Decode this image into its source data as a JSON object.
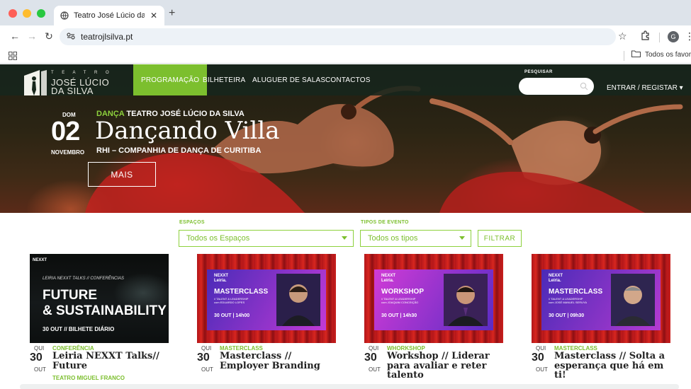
{
  "browser": {
    "tab_title": "Teatro José Lúcio da Silva – ",
    "url": "teatrojlsilva.pt",
    "bookmarks_folder": "Todos os favoritos",
    "profile_initial": "G",
    "icons": [
      "back-icon",
      "forward-icon",
      "reload-icon",
      "site-info-icon",
      "star-icon",
      "extensions-icon",
      "menu-icon",
      "apps-icon",
      "folder-icon"
    ]
  },
  "site": {
    "logo": {
      "small": "T E A T R O",
      "line1": "JOSÉ LÚCIO",
      "line2": "DA SILVA"
    },
    "nav": [
      "PROGRAMAÇÃO",
      "BILHETEIRA",
      "ALUGUER DE SALAS",
      "CONTACTOS"
    ],
    "search_label": "PESQUISAR",
    "login": "ENTRAR / REGISTAR ▾",
    "colors": {
      "accent": "#7cbf2e",
      "nav_bg": "#17261c"
    }
  },
  "hero": {
    "day_of_week": "DOM",
    "day": "02",
    "month": "NOVEMBRO",
    "category": "DANÇA",
    "venue": "TEATRO JOSÉ LÚCIO DA SILVA",
    "title": "Dançando Villa",
    "company": "RHI – COMPANHIA DE DANÇA DE CURITIBA",
    "more_button": "MAIS"
  },
  "filters": {
    "spaces_label": "ESPAÇOS",
    "spaces_value": "Todos os Espaços",
    "types_label": "TIPOS DE EVENTO",
    "types_value": "Todos os tipos",
    "filter_button": "FILTRAR"
  },
  "events": [
    {
      "dow": "QUI",
      "day": "30",
      "month": "OUT",
      "category": "CONFERÊNCIA",
      "title": "Leiria NEXXT Talks// Future",
      "venue": "TEATRO MIGUEL FRANCO",
      "poster": {
        "brand": "NEXXT",
        "tagline": "LEIRIA NEXXT TALKS // CONFERÊNCIAS",
        "line1": "FUTURE",
        "line2": "& SUSTAINABILITY",
        "date": "30 OUT // BILHETE DIÁRIO"
      }
    },
    {
      "dow": "QUI",
      "day": "30",
      "month": "OUT",
      "category": "MASTERCLASS",
      "title": "Masterclass // Employer Branding",
      "venue": "",
      "poster": {
        "brand": "NEXXT",
        "brand2": "Leiria.",
        "kind": "MASTERCLASS",
        "small1": "// TALENT & LEADERSHIP",
        "small2": "com EDUARDO LOPES",
        "date": "30 OUT | 14h00",
        "gradient": [
          "#4a2bb8",
          "#c23ad6"
        ]
      }
    },
    {
      "dow": "QUI",
      "day": "30",
      "month": "OUT",
      "category": "WHORKSHOP",
      "title": "Workshop // Liderar para avaliar e reter talento",
      "venue": "",
      "poster": {
        "brand": "NEXXT",
        "brand2": "Leiria.",
        "kind": "WORKSHOP",
        "small1": "// TALENT & LEADERSHIP",
        "small2": "com JOAQUIM CONCEIÇÃO",
        "date": "30 OUT | 14h30",
        "gradient": [
          "#d13bd6",
          "#5a2cc4"
        ]
      }
    },
    {
      "dow": "QUI",
      "day": "30",
      "month": "OUT",
      "category": "MASTERCLASS",
      "title": "Masterclass // Solta a esperança que há em ti!",
      "venue": "",
      "poster": {
        "brand": "NEXXT",
        "brand2": "Leiria.",
        "kind": "MASTERCLASS",
        "small1": "// TALENT & LEADERSHIP",
        "small2": "com JOSÉ MANUEL SERUYA",
        "date": "30 OUT | 09h30",
        "gradient": [
          "#4a2bb8",
          "#b53ad0"
        ]
      }
    }
  ]
}
